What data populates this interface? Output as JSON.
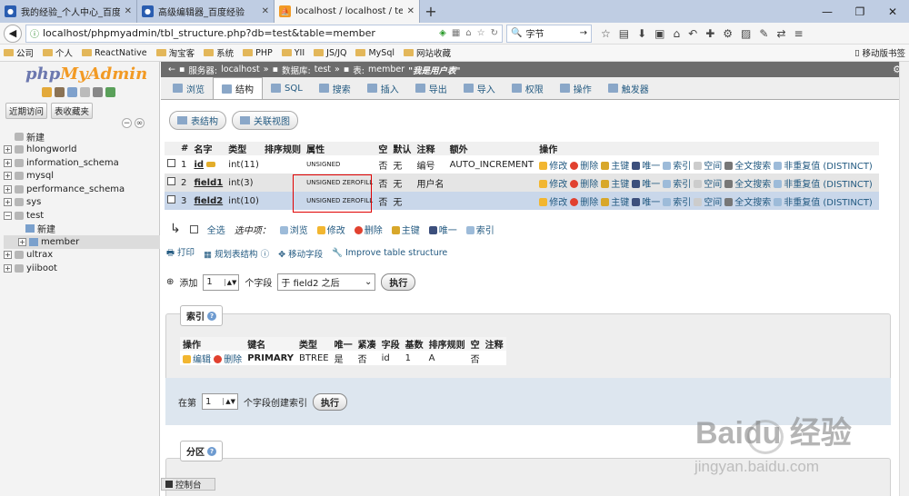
{
  "browser": {
    "tabs": [
      {
        "title": "我的经验_个人中心_百度经",
        "icon": "baidu-paw-icon",
        "active": false
      },
      {
        "title": "高级编辑器_百度经验",
        "icon": "baidu-paw-icon",
        "active": false
      },
      {
        "title": "localhost / localhost / test",
        "icon": "phpmyadmin-icon",
        "active": true
      }
    ],
    "url": "localhost/phpmyadmin/tbl_structure.php?db=test&table=member",
    "search_value": "字节",
    "bookmarks": [
      "公司",
      "个人",
      "ReactNative",
      "淘宝客",
      "系统",
      "PHP",
      "YII",
      "JS/JQ",
      "MySql",
      "网站收藏"
    ],
    "mobile_bookmarks": "移动版书签"
  },
  "sidebar": {
    "logo_php": "php",
    "logo_my": "MyAdmin",
    "recent_label": "近期访问",
    "favorites_label": "表收藏夹",
    "new_label": "新建",
    "databases": [
      "hlongworld",
      "information_schema",
      "mysql",
      "performance_schema",
      "sys"
    ],
    "open_db": "test",
    "open_db_new": "新建",
    "selected_table": "member",
    "databases_after": [
      "ultrax",
      "yiiboot"
    ]
  },
  "breadcrumb": {
    "server_label": "服务器:",
    "server": "localhost",
    "db_label": "数据库:",
    "db": "test",
    "table_label": "表:",
    "table": "member",
    "comment": "\"我是用户表\""
  },
  "tabs": [
    "浏览",
    "结构",
    "SQL",
    "搜索",
    "插入",
    "导出",
    "导入",
    "权限",
    "操作",
    "触发器"
  ],
  "active_tab": "结构",
  "sub_buttons": [
    "表结构",
    "关联视图"
  ],
  "structure": {
    "headers": [
      "#",
      "名字",
      "类型",
      "排序规则",
      "属性",
      "空",
      "默认",
      "注释",
      "额外",
      "操作"
    ],
    "rows": [
      {
        "num": "1",
        "name": "id",
        "type": "int(11)",
        "collation": "",
        "attr": "UNSIGNED",
        "null": "否",
        "default": "无",
        "comment": "编号",
        "extra": "AUTO_INCREMENT"
      },
      {
        "num": "2",
        "name": "field1",
        "type": "int(3)",
        "collation": "",
        "attr": "UNSIGNED ZEROFILL",
        "null": "否",
        "default": "无",
        "comment": "用户名",
        "extra": ""
      },
      {
        "num": "3",
        "name": "field2",
        "type": "int(10)",
        "collation": "",
        "attr": "UNSIGNED ZEROFILL",
        "null": "否",
        "default": "无",
        "comment": "",
        "extra": ""
      }
    ],
    "actions": [
      "修改",
      "删除",
      "主键",
      "唯一",
      "索引",
      "空间",
      "全文搜索",
      "非重复值 (DISTINCT)"
    ]
  },
  "bulk": {
    "check_all": "全选",
    "selected_label": "选中项：",
    "actions": [
      "浏览",
      "修改",
      "删除",
      "主键",
      "唯一",
      "索引"
    ]
  },
  "links": [
    "打印",
    "规划表结构",
    "移动字段",
    "Improve table structure"
  ],
  "add_field": {
    "label": "添加",
    "count": "1",
    "unit": "个字段",
    "position": "于 field2 之后",
    "go": "执行"
  },
  "indexes": {
    "legend": "索引",
    "headers": [
      "操作",
      "键名",
      "类型",
      "唯一",
      "紧凑",
      "字段",
      "基数",
      "排序规则",
      "空",
      "注释"
    ],
    "row": {
      "edit": "编辑",
      "delete": "删除",
      "key": "PRIMARY",
      "type": "BTREE",
      "unique": "是",
      "packed": "否",
      "field": "id",
      "cardinality": "1",
      "collation": "A",
      "null": "否",
      "comment": ""
    },
    "create_prefix": "在第",
    "create_count": "1",
    "create_suffix": "个字段创建索引",
    "create_go": "执行"
  },
  "partition": {
    "legend": "分区"
  },
  "console": "控制台",
  "watermark": {
    "brand": "Baidu 经验",
    "url": "jingyan.baidu.com"
  }
}
